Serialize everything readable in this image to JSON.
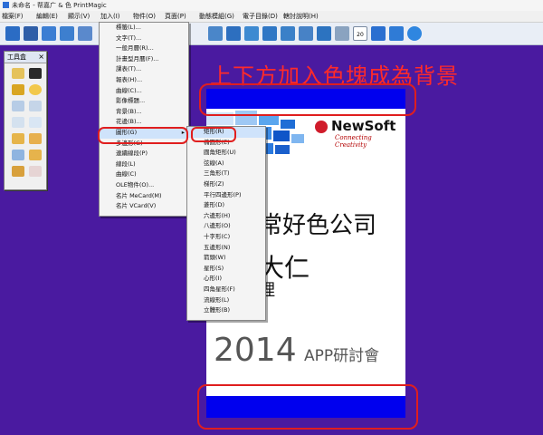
{
  "window": {
    "title": "未命名 - 帮嘉广 & 色 PrintMagic"
  },
  "menubar": {
    "items": [
      "檔案(F)",
      "編輯(E)",
      "顯示(V)",
      "加入(I)",
      "物件(O)",
      "頁面(P)",
      "動態模組(G)",
      "電子目錄(D)",
      "轄討說明(H)"
    ]
  },
  "toolbar": {
    "icons": [
      "open-folder-icon",
      "save-icon",
      "print-icon",
      "monitor-icon",
      "print-preview-icon",
      "magnifier-icon",
      "image-icon",
      "image-icon",
      "image-icon",
      "image-icon",
      "camera-icon",
      "person-icon",
      "calendar-icon",
      "help-icon",
      "refresh-icon",
      "play-icon"
    ],
    "calendar_number": "20"
  },
  "toolbox": {
    "title": "工具盒",
    "close": "×"
  },
  "insert_menu": {
    "items": [
      "標籤(L)...",
      "文字(T)...",
      "一般月曆(R)...",
      "計畫型月曆(F)...",
      "課表(T)...",
      "報表(H)...",
      "曲線(C)...",
      "影像標題...",
      "背景(B)...",
      "花邊(B)...",
      "圖形(G)",
      "多邊形(G)",
      "連續線段(P)",
      "線段(L)",
      "曲線(C)",
      "OLE物件(O)...",
      "名片 MeCard(M)",
      "名片 VCard(V)"
    ]
  },
  "shape_submenu": {
    "items": [
      "矩形(R)",
      "橢圓形(E)",
      "圓角矩形(U)",
      "弦線(A)",
      "三角形(T)",
      "梯形(Z)",
      "平行四邊形(P)",
      "菱形(D)",
      "六邊形(H)",
      "八邊形(O)",
      "十字形(C)",
      "五邊形(N)",
      "箭頭(W)",
      "星形(S)",
      "心形(I)",
      "四角星形(F)",
      "流線形(L)",
      "立體形(B)"
    ]
  },
  "annotation": {
    "text": "上下方加入色塊成為背景"
  },
  "card": {
    "logo_brand": "NewSoft",
    "logo_tagline": "Connecting Creativity",
    "company": "常好色公司",
    "person": "大仁",
    "person2": "理",
    "year": "2014",
    "event": "APP研討會"
  },
  "colors": {
    "canvas": "#4a1aa0",
    "band": "#0000ee",
    "highlight": "#e01e1e"
  }
}
